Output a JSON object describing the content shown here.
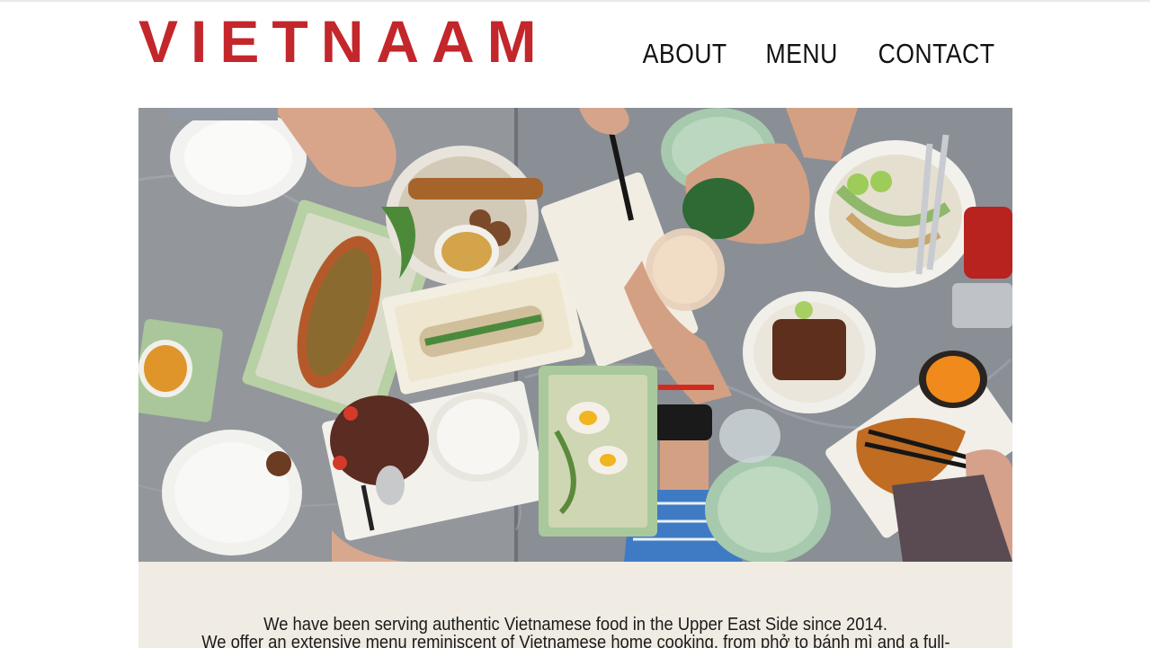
{
  "brand": {
    "logo_text": "VIETNAAM",
    "logo_color": "#c3262b"
  },
  "nav": {
    "items": [
      {
        "label": "ABOUT"
      },
      {
        "label": "MENU"
      },
      {
        "label": "CONTACT"
      }
    ]
  },
  "hero": {
    "image_name": "vietnamese-food-table-photo"
  },
  "about": {
    "line1": "We have been serving authentic Vietnamese food in the Upper East Side since 2014.",
    "line2": "We offer an extensive menu reminiscent of Vietnamese home cooking, from phở to bánh mì and a full-",
    "band_color": "#f0ece3"
  }
}
